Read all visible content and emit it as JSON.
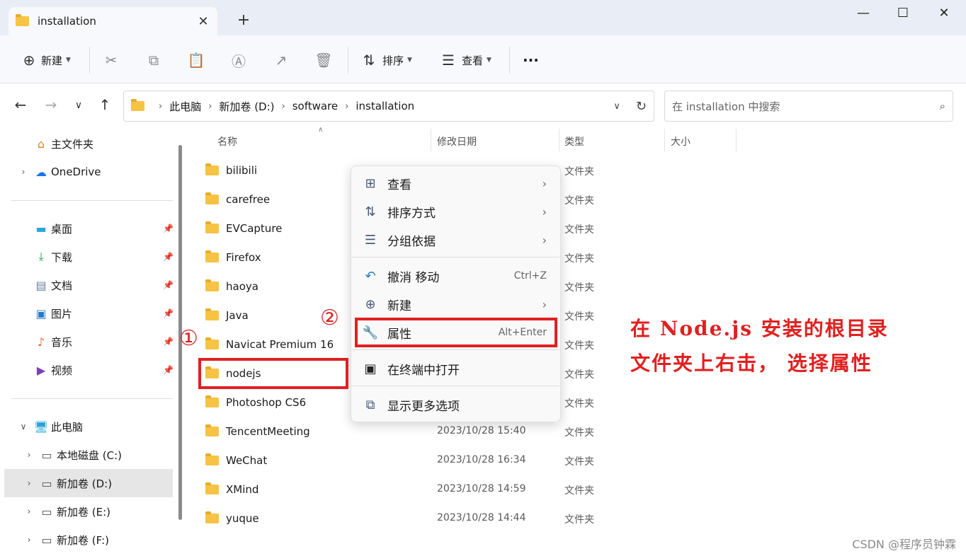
{
  "window": {
    "tab_title": "installation",
    "new_tab": "+",
    "minimize": "—",
    "maximize": "☐",
    "close": "✕"
  },
  "toolbar": {
    "new_label": "新建",
    "sort_label": "排序",
    "view_label": "查看",
    "more_label": "···"
  },
  "address": {
    "segments": [
      "此电脑",
      "新加卷 (D:)",
      "software",
      "installation"
    ],
    "search_placeholder": "在 installation 中搜索"
  },
  "sidebar": {
    "top": [
      {
        "label": "主文件夹"
      },
      {
        "label": "OneDrive"
      }
    ],
    "quick": [
      {
        "label": "桌面"
      },
      {
        "label": "下载"
      },
      {
        "label": "文档"
      },
      {
        "label": "图片"
      },
      {
        "label": "音乐"
      },
      {
        "label": "视频"
      }
    ],
    "pc": [
      {
        "label": "此电脑"
      },
      {
        "label": "本地磁盘 (C:)"
      },
      {
        "label": "新加卷 (D:)"
      },
      {
        "label": "新加卷 (E:)"
      },
      {
        "label": "新加卷 (F:)"
      }
    ]
  },
  "columns": {
    "name": "名称",
    "date": "修改日期",
    "type": "类型",
    "size": "大小"
  },
  "files": [
    {
      "name": "bilibili",
      "date": "",
      "type": "文件夹"
    },
    {
      "name": "carefree",
      "date": "",
      "type": "文件夹"
    },
    {
      "name": "EVCapture",
      "date": "",
      "type": "文件夹"
    },
    {
      "name": "Firefox",
      "date": "",
      "type": "文件夹"
    },
    {
      "name": "haoya",
      "date": "",
      "type": "文件夹"
    },
    {
      "name": "Java",
      "date": "",
      "type": "文件夹"
    },
    {
      "name": "Navicat Premium 16",
      "date": "",
      "type": "文件夹"
    },
    {
      "name": "nodejs",
      "date": "",
      "type": "文件夹"
    },
    {
      "name": "Photoshop CS6",
      "date": "",
      "type": "文件夹"
    },
    {
      "name": "TencentMeeting",
      "date": "2023/10/28 15:40",
      "type": "文件夹"
    },
    {
      "name": "WeChat",
      "date": "2023/10/28 16:34",
      "type": "文件夹"
    },
    {
      "name": "XMind",
      "date": "2023/10/28 14:59",
      "type": "文件夹"
    },
    {
      "name": "yuque",
      "date": "2023/10/28 14:44",
      "type": "文件夹"
    }
  ],
  "context_menu": {
    "view": "查看",
    "sort": "排序方式",
    "group": "分组依据",
    "undo": "撤消 移动",
    "undo_key": "Ctrl+Z",
    "new": "新建",
    "properties": "属性",
    "properties_key": "Alt+Enter",
    "terminal": "在终端中打开",
    "more": "显示更多选项"
  },
  "annotations": {
    "step1": "①",
    "step2": "②",
    "line1": "在 Node.js 安装的根目录",
    "line2": "文件夹上右击， 选择属性"
  },
  "watermark": "CSDN @程序员钟霖"
}
